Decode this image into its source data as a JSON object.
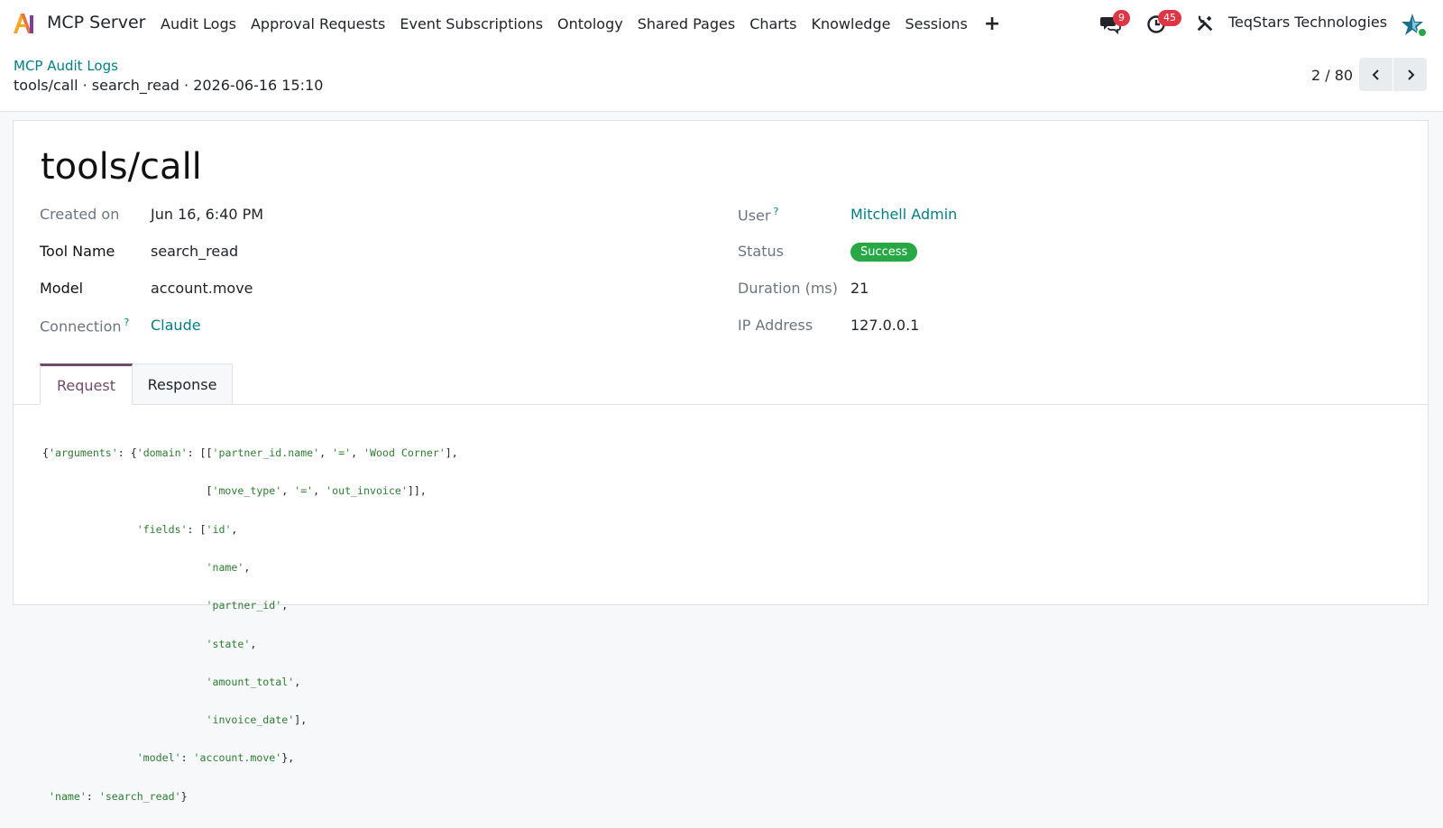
{
  "app": {
    "name": "MCP Server",
    "menu": [
      "Audit Logs",
      "Approval Requests",
      "Event Subscriptions",
      "Ontology",
      "Shared Pages",
      "Charts",
      "Knowledge",
      "Sessions"
    ],
    "plus_label": "+"
  },
  "systray": {
    "messages_count": "9",
    "activities_count": "45",
    "company": "TeqStars Technologies"
  },
  "breadcrumb": {
    "parent": "MCP Audit Logs",
    "current": "tools/call · search_read · 2026-06-16 15:10"
  },
  "pager": {
    "value": "2 / 80"
  },
  "record": {
    "title": "tools/call",
    "created_on_label": "Created on",
    "created_on": "Jun 16, 6:40 PM",
    "tool_name_label": "Tool Name",
    "tool_name": "search_read",
    "model_label": "Model",
    "model": "account.move",
    "connection_label": "Connection",
    "connection": "Claude",
    "user_label": "User",
    "user": "Mitchell Admin",
    "status_label": "Status",
    "status": "Success",
    "duration_label": "Duration (ms)",
    "duration": "21",
    "ip_label": "IP Address",
    "ip": "127.0.0.1",
    "help_mark": "?"
  },
  "tabs": {
    "request": "Request",
    "response": "Response"
  },
  "request_code": [
    "{'arguments': {'domain': [['partner_id.name', '=', 'Wood Corner'],",
    "                          ['move_type', '=', 'out_invoice']],",
    "               'fields': ['id',",
    "                          'name',",
    "                          'partner_id',",
    "                          'state',",
    "                          'amount_total',",
    "                          'invoice_date'],",
    "               'model': 'account.move'},",
    " 'name': 'search_read'}"
  ],
  "colors": {
    "accent": "#017e84",
    "brand": "#714b67",
    "success": "#28a745",
    "badge": "#dc3545"
  }
}
